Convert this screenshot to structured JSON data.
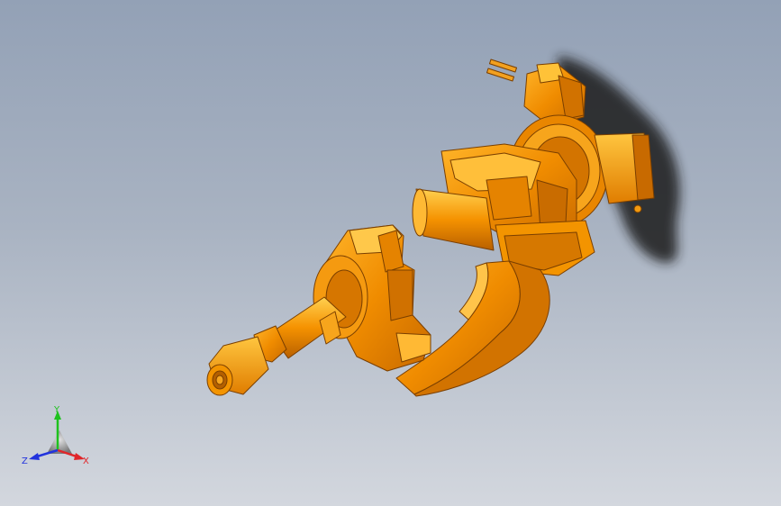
{
  "viewport": {
    "background_top": "#93a1b6",
    "background_bottom": "#d3d7de",
    "model_color": "#f08c00",
    "model_highlight": "#ffc238",
    "model_shadow_color": "#b35f00",
    "cast_shadow_color": "#1a1a1a"
  },
  "triad": {
    "y_label": "Y",
    "x_label": "X",
    "z_label": "Z",
    "y_color": "#1ec21e",
    "x_color": "#e0262a",
    "z_color": "#2233dd"
  }
}
